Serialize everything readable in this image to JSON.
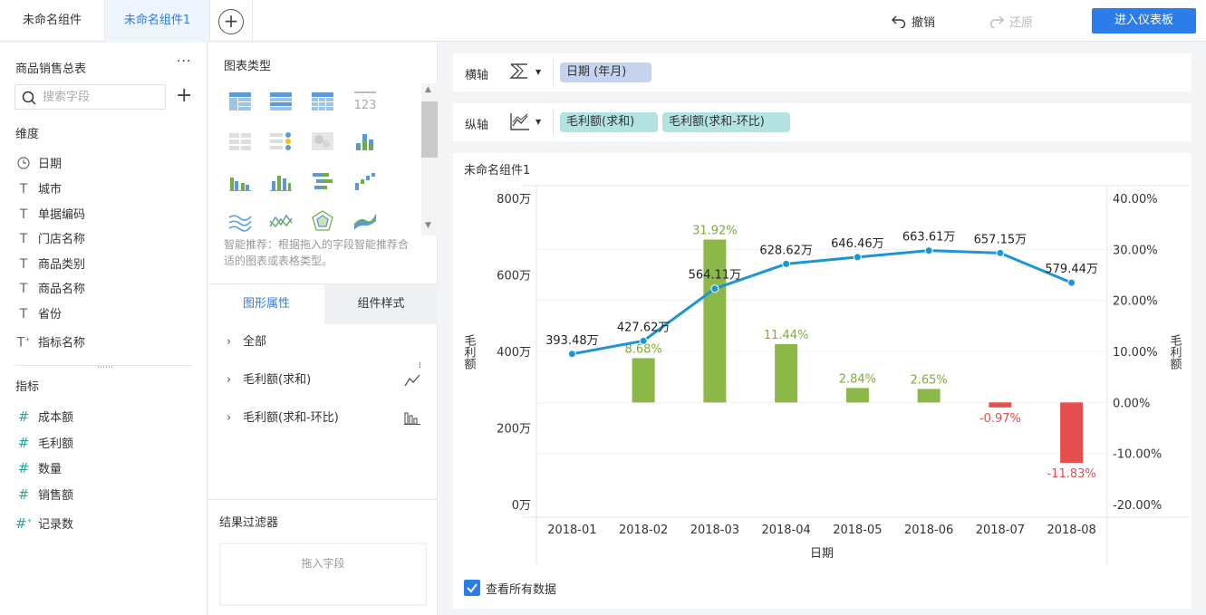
{
  "tabs": [
    {
      "label": "未命名组件"
    },
    {
      "label": "未命名组件1"
    }
  ],
  "toolbar": {
    "add_tab": "+",
    "undo_label": "撤销",
    "redo_label": "还原",
    "enter_dashboard_label": "进入仪表板"
  },
  "left_panel": {
    "dataset_title": "商品销售总表",
    "more": "···",
    "search_placeholder": "搜索字段",
    "add_field": "+",
    "dimensions_label": "维度",
    "dimensions": [
      {
        "icon": "clock-icon",
        "label": "日期"
      },
      {
        "icon": "text-field-icon",
        "label": "城市"
      },
      {
        "icon": "text-field-icon",
        "label": "单据编码"
      },
      {
        "icon": "text-field-icon",
        "label": "门店名称"
      },
      {
        "icon": "text-field-icon",
        "label": "商品类别"
      },
      {
        "icon": "text-field-icon",
        "label": "商品名称"
      },
      {
        "icon": "text-field-icon",
        "label": "省份"
      },
      {
        "icon": "text-field-icon",
        "label": "指标名称"
      }
    ],
    "measures_label": "指标",
    "measures": [
      {
        "icon": "hash-icon",
        "label": "成本额"
      },
      {
        "icon": "hash-icon",
        "label": "毛利额"
      },
      {
        "icon": "hash-icon",
        "label": "数量"
      },
      {
        "icon": "hash-icon",
        "label": "销售额"
      },
      {
        "icon": "hash-icon",
        "label": "记录数"
      }
    ]
  },
  "mid_panel": {
    "chart_type_title": "图表类型",
    "smart_tip": "智能推荐：根据拖入的字段智能推荐合适的图表或表格类型。",
    "tab_graphic": "图形属性",
    "tab_style": "组件样式",
    "props": [
      {
        "label": "全部"
      },
      {
        "label": "毛利额(求和)"
      },
      {
        "label": "毛利额(求和-环比)"
      }
    ],
    "filter_title": "结果过滤器",
    "drop_hint": "拖入字段"
  },
  "axes": {
    "x_label": "横轴",
    "x_fields": [
      "日期 (年月)"
    ],
    "y_label": "纵轴",
    "y_fields": [
      "毛利额(求和)",
      "毛利额(求和-环比)"
    ]
  },
  "chart_card": {
    "title": "未命名组件1",
    "show_all_label": "查看所有数据"
  },
  "colors": {
    "accent": "#2b7de9",
    "bar_positive": "#8cb84a",
    "bar_negative": "#e64d4d",
    "line": "#1a96d4",
    "positive_label": "#7cad36",
    "negative_label": "#e64d4d"
  },
  "chart_data": {
    "type": "bar",
    "categories": [
      "2018-01",
      "2018-02",
      "2018-03",
      "2018-04",
      "2018-05",
      "2018-06",
      "2018-07",
      "2018-08"
    ],
    "xlabel": "日期",
    "ylabel_left": "毛利额",
    "ylabel_right": "毛利额",
    "y_left_ticks": [
      "800万",
      "600万",
      "400万",
      "200万",
      "0万"
    ],
    "y_right_ticks": [
      "40.00%",
      "30.00%",
      "20.00%",
      "10.00%",
      "0.00%",
      "-10.00%",
      "-20.00%"
    ],
    "ylim_left": [
      0,
      800
    ],
    "ylim_right": [
      -20,
      40
    ],
    "series": [
      {
        "name": "毛利额(求和)",
        "type": "line",
        "axis": "left",
        "values": [
          393.48,
          427.62,
          564.11,
          628.62,
          646.46,
          663.61,
          657.15,
          579.44
        ],
        "labels": [
          "393.48万",
          "427.62万",
          "564.11万",
          "628.62万",
          "646.46万",
          "663.61万",
          "657.15万",
          "579.44万"
        ]
      },
      {
        "name": "毛利额(求和-环比)",
        "type": "bar",
        "axis": "right",
        "values": [
          null,
          8.68,
          31.92,
          11.44,
          2.84,
          2.65,
          -0.97,
          -11.83
        ],
        "labels": [
          "",
          "8.68%",
          "31.92%",
          "11.44%",
          "2.84%",
          "2.65%",
          "-0.97%",
          "-11.83%"
        ]
      }
    ]
  }
}
